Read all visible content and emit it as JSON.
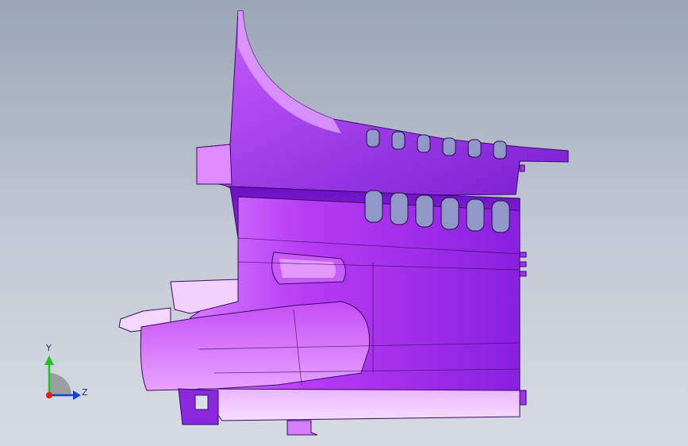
{
  "viewport": {
    "background_top": "#9aa5b6",
    "background_bottom": "#d6dbe3",
    "model_color": "#b545f0"
  },
  "triad": {
    "y_label": "Y",
    "z_label": "Z",
    "y_color": "#22c02a",
    "z_color": "#1a3fd6",
    "x_color": "#e01b1b"
  }
}
